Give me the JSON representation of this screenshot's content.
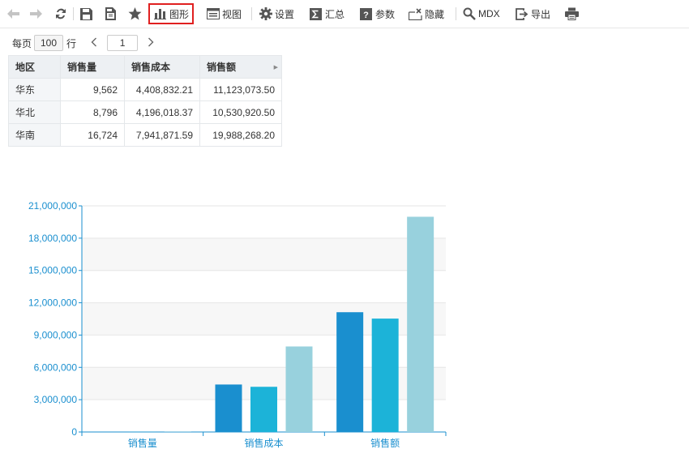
{
  "toolbar": {
    "items": [
      {
        "id": "back",
        "icon": "back-arrow-icon",
        "label": ""
      },
      {
        "id": "forward",
        "icon": "forward-arrow-icon",
        "label": ""
      },
      {
        "id": "refresh",
        "icon": "refresh-icon",
        "label": ""
      },
      {
        "id": "save",
        "icon": "save-icon",
        "label": ""
      },
      {
        "id": "save-as",
        "icon": "save-as-icon",
        "label": ""
      },
      {
        "id": "favorite",
        "icon": "star-icon",
        "label": ""
      },
      {
        "id": "chart",
        "icon": "bar-chart-icon",
        "label": "图形",
        "active": true
      },
      {
        "id": "view",
        "icon": "view-icon",
        "label": "视图"
      },
      {
        "id": "settings",
        "icon": "gear-icon",
        "label": "设置"
      },
      {
        "id": "summary",
        "icon": "sigma-icon",
        "label": "汇总"
      },
      {
        "id": "params",
        "icon": "question-icon",
        "label": "参数"
      },
      {
        "id": "hide",
        "icon": "hide-icon",
        "label": "隐藏"
      },
      {
        "id": "mdx",
        "icon": "magnifier-icon",
        "label": "MDX"
      },
      {
        "id": "export",
        "icon": "export-icon",
        "label": "导出"
      },
      {
        "id": "print",
        "icon": "printer-icon",
        "label": ""
      }
    ]
  },
  "pager": {
    "per_page_label": "每页",
    "per_page_value": "100",
    "rows_label": "行",
    "prev_icon": "chevron-left-icon",
    "next_icon": "chevron-right-icon",
    "page_value": "1"
  },
  "table": {
    "headers": [
      "地区",
      "销售量",
      "销售成本",
      "销售额"
    ],
    "rows": [
      [
        "华东",
        "9,562",
        "4,408,832.21",
        "11,123,073.50"
      ],
      [
        "华北",
        "8,796",
        "4,196,018.37",
        "10,530,920.50"
      ],
      [
        "华南",
        "16,724",
        "7,941,871.59",
        "19,988,268.20"
      ]
    ]
  },
  "chart_data": {
    "type": "bar",
    "categories": [
      "销售量",
      "销售成本",
      "销售额"
    ],
    "series": [
      {
        "values": [
          9562,
          4408832.21,
          11123073.5
        ],
        "color": "#1a8fcf"
      },
      {
        "values": [
          8796,
          4196018.37,
          10530920.5
        ],
        "color": "#1cb3d8"
      },
      {
        "values": [
          16724,
          7941871.59,
          19988268.2
        ],
        "color": "#98d1dd"
      }
    ],
    "y_ticks": [
      "0",
      "3,000,000",
      "6,000,000",
      "9,000,000",
      "12,000,000",
      "15,000,000",
      "18,000,000",
      "21,000,000"
    ],
    "ylim": [
      0,
      21000000
    ],
    "grid": true,
    "legend": "none",
    "axis_color": "#1a8fcf",
    "title": "",
    "xlabel": "",
    "ylabel": ""
  }
}
